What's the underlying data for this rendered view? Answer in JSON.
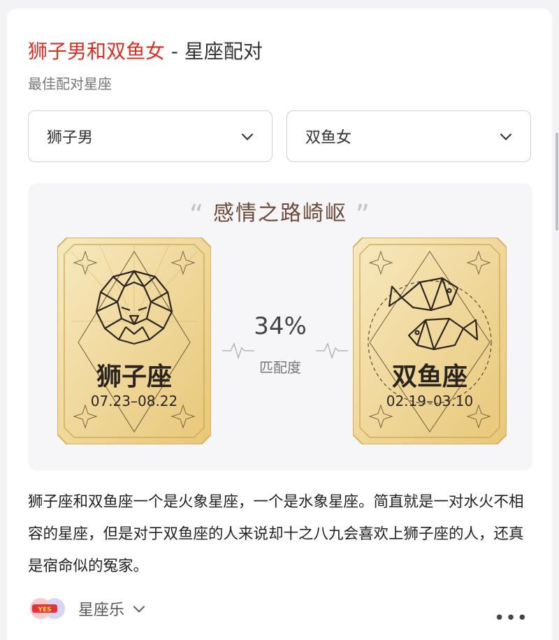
{
  "header": {
    "title_highlight": "狮子男和双鱼女",
    "title_rest": " - 星座配对",
    "subtitle": "最佳配对星座"
  },
  "selectors": {
    "left_value": "狮子男",
    "right_value": "双鱼女"
  },
  "match": {
    "headline": "感情之路崎岖",
    "percent": "34%",
    "percent_label": "匹配度",
    "left_sign": {
      "name": "狮子座",
      "dates": "07.23–08.22",
      "icon": "lion-icon"
    },
    "right_sign": {
      "name": "双鱼座",
      "dates": "02.19–03.10",
      "icon": "fish-icon"
    }
  },
  "description": "狮子座和双鱼座一个是火象星座，一个是水象星座。简直就是一对水火不相容的星座，但是对于双鱼座的人来说却十之八九会喜欢上狮子座的人，还真是宿命似的冤家。",
  "footer": {
    "source_name": "星座乐",
    "more": "•••"
  },
  "colors": {
    "accent_red": "#d93025",
    "gold": "#d9b45a",
    "gold_light": "#f3e3b3",
    "brown": "#6b4a3a"
  }
}
